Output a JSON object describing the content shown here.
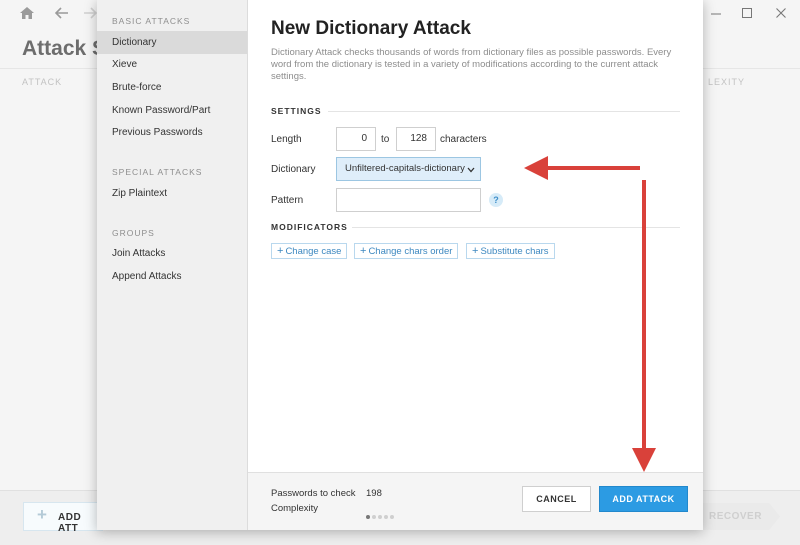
{
  "background": {
    "page_title": "Attack S",
    "col_left": "ATTACK",
    "col_right": "LEXITY",
    "add_button": "ADD ATT",
    "recover_button": "RECOVER"
  },
  "sidebar": {
    "basic_heading": "BASIC ATTACKS",
    "basic_items": [
      "Dictionary",
      "Xieve",
      "Brute-force",
      "Known Password/Part",
      "Previous Passwords"
    ],
    "special_heading": "SPECIAL ATTACKS",
    "special_items": [
      "Zip Plaintext"
    ],
    "groups_heading": "GROUPS",
    "group_items": [
      "Join Attacks",
      "Append Attacks"
    ]
  },
  "main": {
    "title": "New Dictionary Attack",
    "description": "Dictionary Attack checks thousands of words from dictionary files as possible passwords. Every word from the dictionary is tested in a variety of modifications according to the current attack settings.",
    "settings_heading": "SETTINGS",
    "length_label": "Length",
    "length_from": "0",
    "length_to_label": "to",
    "length_to": "128",
    "length_unit": "characters",
    "dictionary_label": "Dictionary",
    "dictionary_value": "Unfiltered-capitals-dictionary",
    "pattern_label": "Pattern",
    "pattern_value": "",
    "help_glyph": "?",
    "modificators_heading": "MODIFICATORS",
    "modificators": [
      "Change case",
      "Change chars order",
      "Substitute chars"
    ]
  },
  "footer": {
    "passwords_label": "Passwords to check",
    "passwords_value": "198",
    "complexity_label": "Complexity",
    "complexity_level": 1,
    "complexity_max": 5,
    "cancel_label": "CANCEL",
    "add_label": "ADD ATTACK"
  },
  "colors": {
    "accent": "#2c9be3",
    "annotation_arrow": "#d9413a"
  }
}
